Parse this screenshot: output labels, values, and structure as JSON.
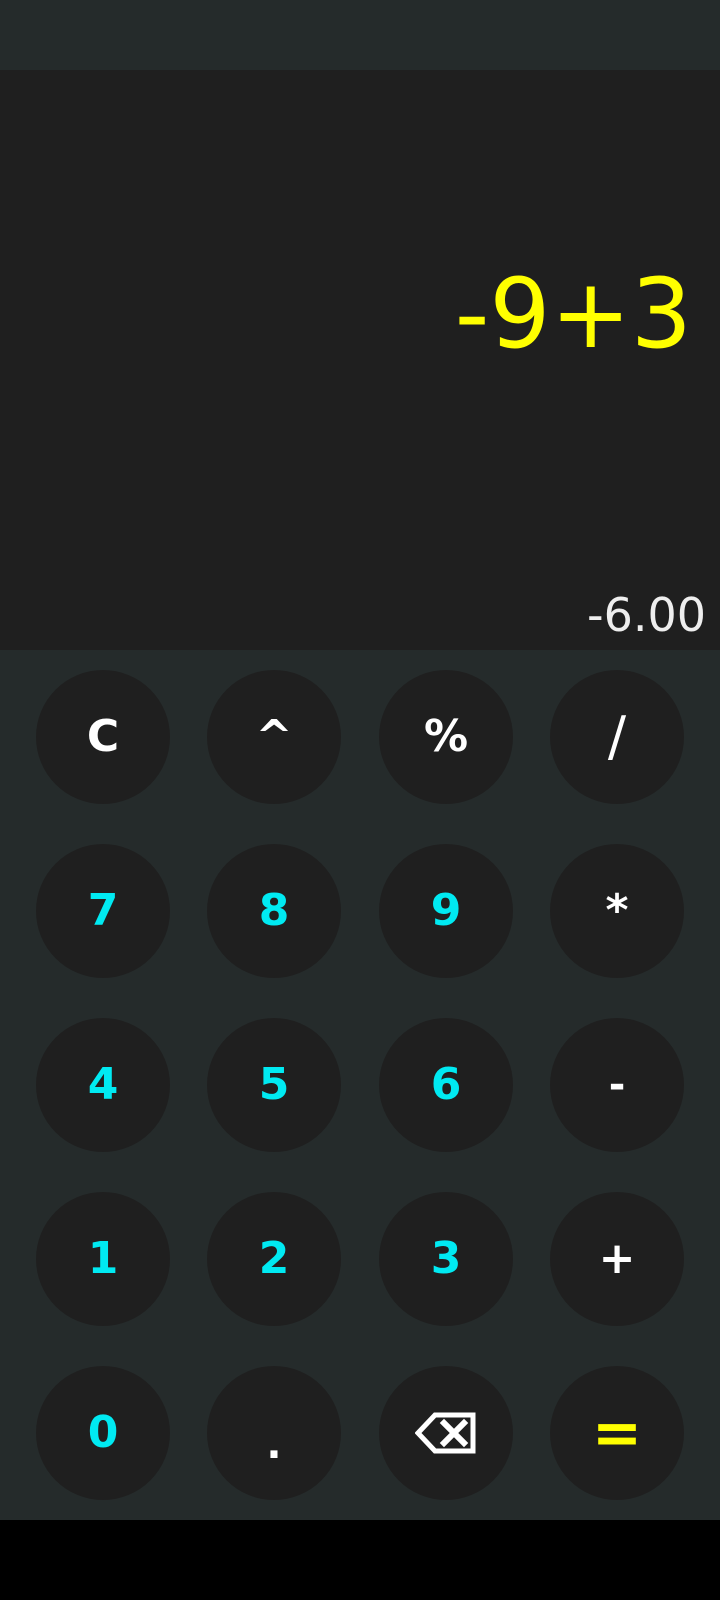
{
  "display": {
    "expression": "-9+3",
    "result": "-6.00"
  },
  "keys": {
    "clear": "C",
    "power": "^",
    "percent": "%",
    "divide": "/",
    "seven": "7",
    "eight": "8",
    "nine": "9",
    "multiply": "*",
    "four": "4",
    "five": "5",
    "six": "6",
    "subtract": "-",
    "one": "1",
    "two": "2",
    "three": "3",
    "add": "+",
    "zero": "0",
    "decimal": ".",
    "backspace_icon": "backspace-icon",
    "equals": "="
  },
  "colors": {
    "expression": "#ffff00",
    "result": "#eeeeee",
    "digits": "#00eaf2",
    "operators": "#ffffff",
    "equals": "#ffff00",
    "key_background": "#1f1f1f",
    "keypad_background": "#252b2b",
    "display_background": "#1f1f1f"
  }
}
